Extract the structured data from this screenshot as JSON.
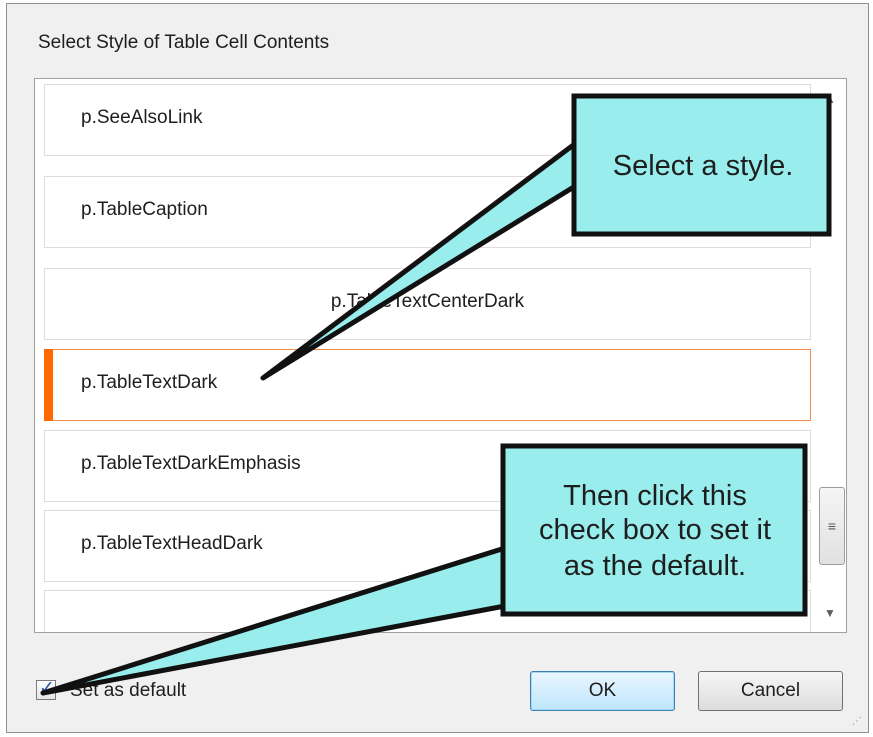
{
  "dialog": {
    "title": "Select Style of Table Cell Contents"
  },
  "style_list": {
    "items": [
      {
        "label": "p.SeeAlsoLink",
        "selected": false
      },
      {
        "label": "p.TableCaption",
        "selected": false
      },
      {
        "label": "p.TableTextCenterDark",
        "selected": false
      },
      {
        "label": "p.TableTextDark",
        "selected": true
      },
      {
        "label": "p.TableTextDarkEmphasis",
        "selected": false
      },
      {
        "label": "p.TableTextHeadDark",
        "selected": false
      },
      {
        "label": "",
        "selected": false
      }
    ]
  },
  "set_as_default": {
    "label": "Set as default",
    "checked": true
  },
  "buttons": {
    "ok": "OK",
    "cancel": "Cancel"
  },
  "callouts": {
    "select_style": "Select a style.",
    "checkbox_line1": "Then click this",
    "checkbox_line2": "check box to set it",
    "checkbox_line3": "as the default."
  },
  "colors": {
    "callout_fill": "#99eded",
    "selection_accent": "#ff6a00"
  }
}
